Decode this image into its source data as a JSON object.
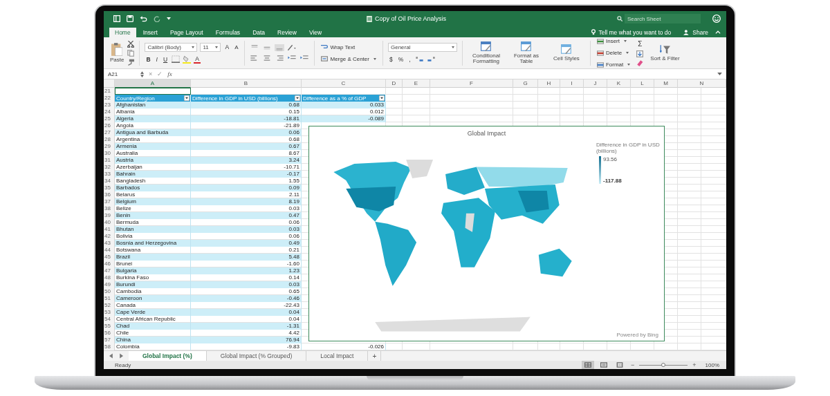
{
  "window": {
    "title": "Copy of Oil Price Analysis"
  },
  "search": {
    "placeholder": "Search Sheet"
  },
  "tabs": [
    {
      "label": "Home",
      "selected": true
    },
    {
      "label": "Insert",
      "selected": false
    },
    {
      "label": "Page Layout",
      "selected": false
    },
    {
      "label": "Formulas",
      "selected": false
    },
    {
      "label": "Data",
      "selected": false
    },
    {
      "label": "Review",
      "selected": false
    },
    {
      "label": "View",
      "selected": false
    }
  ],
  "tell_me": "Tell me what you want to do",
  "share": "Share",
  "ribbon": {
    "paste": "Paste",
    "font": "Calibri (Body)",
    "font_size": "11",
    "grow_font": "A",
    "shrink_font": "A",
    "bold": "B",
    "italic": "I",
    "underline": "U",
    "font_color": "A",
    "wrap_text": "Wrap Text",
    "merge_center": "Merge & Center",
    "number_format": "General",
    "currency": "$",
    "percent": "%",
    "comma": ",",
    "styles": [
      {
        "kind": "conditional",
        "label": "Conditional Formatting"
      },
      {
        "kind": "table",
        "label": "Format as Table"
      },
      {
        "kind": "cell",
        "label": "Cell Styles"
      }
    ],
    "cells": [
      {
        "kind": "insert",
        "label": "Insert"
      },
      {
        "kind": "delete",
        "label": "Delete"
      },
      {
        "kind": "format",
        "label": "Format"
      }
    ],
    "autosum": "Σ",
    "sort_filter": "Sort & Filter"
  },
  "formula_bar": {
    "name_box": "A21",
    "cancel": "×",
    "enter": "✓",
    "function_label": "fx"
  },
  "sheet": {
    "columns": [
      "A",
      "B",
      "C",
      "D",
      "E",
      "F",
      "G",
      "H",
      "I",
      "J",
      "K",
      "L",
      "M",
      "N"
    ],
    "active_row": "21",
    "header": {
      "number": "22",
      "cells": [
        "Country/Region",
        "Difference in GDP in USD (billions)",
        "Difference as a % of GDP"
      ]
    },
    "rows": [
      {
        "number": "23",
        "cells": [
          "Afghanistan",
          "0.68",
          "0.033"
        ]
      },
      {
        "number": "24",
        "cells": [
          "Albania",
          "0.15",
          "0.012"
        ]
      },
      {
        "number": "25",
        "cells": [
          "Algeria",
          "-18.81",
          "-0.089"
        ]
      },
      {
        "number": "26",
        "cells": [
          "Angola",
          "-21.89"
        ]
      },
      {
        "number": "27",
        "cells": [
          "Antigua and Barbuda",
          "0.06"
        ]
      },
      {
        "number": "28",
        "cells": [
          "Argentina",
          "0.68"
        ]
      },
      {
        "number": "29",
        "cells": [
          "Armenia",
          "0.67"
        ]
      },
      {
        "number": "30",
        "cells": [
          "Australia",
          "8.67"
        ]
      },
      {
        "number": "31",
        "cells": [
          "Austria",
          "3.24"
        ]
      },
      {
        "number": "32",
        "cells": [
          "Azerbaijan",
          "-10.71"
        ]
      },
      {
        "number": "33",
        "cells": [
          "Bahrain",
          "-0.17"
        ]
      },
      {
        "number": "34",
        "cells": [
          "Bangladesh",
          "1.55"
        ]
      },
      {
        "number": "35",
        "cells": [
          "Barbados",
          "0.09"
        ]
      },
      {
        "number": "36",
        "cells": [
          "Belarus",
          "2.11"
        ]
      },
      {
        "number": "37",
        "cells": [
          "Belgium",
          "8.19"
        ]
      },
      {
        "number": "38",
        "cells": [
          "Belize",
          "0.03"
        ]
      },
      {
        "number": "39",
        "cells": [
          "Benin",
          "0.47"
        ]
      },
      {
        "number": "40",
        "cells": [
          "Bermuda",
          "0.06"
        ]
      },
      {
        "number": "41",
        "cells": [
          "Bhutan",
          "0.03"
        ]
      },
      {
        "number": "42",
        "cells": [
          "Bolivia",
          "0.06"
        ]
      },
      {
        "number": "43",
        "cells": [
          "Bosnia and Herzegovina",
          "0.49"
        ]
      },
      {
        "number": "44",
        "cells": [
          "Botswana",
          "0.21"
        ]
      },
      {
        "number": "45",
        "cells": [
          "Brazil",
          "5.48"
        ]
      },
      {
        "number": "46",
        "cells": [
          "Brunei",
          "-1.60"
        ]
      },
      {
        "number": "47",
        "cells": [
          "Bulgaria",
          "1.23"
        ]
      },
      {
        "number": "48",
        "cells": [
          "Burkina Faso",
          "0.14"
        ]
      },
      {
        "number": "49",
        "cells": [
          "Burundi",
          "0.03"
        ]
      },
      {
        "number": "50",
        "cells": [
          "Cambodia",
          "0.65"
        ]
      },
      {
        "number": "51",
        "cells": [
          "Cameroon",
          "-0.46"
        ]
      },
      {
        "number": "52",
        "cells": [
          "Canada",
          "-22.43"
        ]
      },
      {
        "number": "53",
        "cells": [
          "Cape Verde",
          "0.04"
        ]
      },
      {
        "number": "54",
        "cells": [
          "Central African Republic",
          "0.04"
        ]
      },
      {
        "number": "55",
        "cells": [
          "Chad",
          "-1.31"
        ]
      },
      {
        "number": "56",
        "cells": [
          "Chile",
          "4.42"
        ]
      },
      {
        "number": "57",
        "cells": [
          "China",
          "76.94"
        ]
      },
      {
        "number": "58",
        "cells": [
          "Colombia",
          "-9.83",
          "-0.026"
        ]
      }
    ]
  },
  "map_chart": {
    "title": "Global Impact",
    "legend_title": "Difference in GDP in USD (billions)",
    "legend_max": "93.56",
    "legend_min": "-117.88",
    "credit": "Powered by Bing"
  },
  "sheet_tabs": [
    {
      "label": "Global Impact (%)",
      "selected": true
    },
    {
      "label": "Global Impact (% Grouped)",
      "selected": false
    },
    {
      "label": "Local Impact",
      "selected": false
    }
  ],
  "add_sheet": "+",
  "status_bar": {
    "status": "Ready",
    "views": [
      {
        "kind": "normal",
        "selected": true
      },
      {
        "kind": "page_layout",
        "selected": false
      },
      {
        "kind": "page_break",
        "selected": false
      }
    ],
    "zoom_out": "−",
    "zoom_in": "+",
    "zoom": {
      "level": 0.5
    },
    "zoom_label": "100%"
  }
}
